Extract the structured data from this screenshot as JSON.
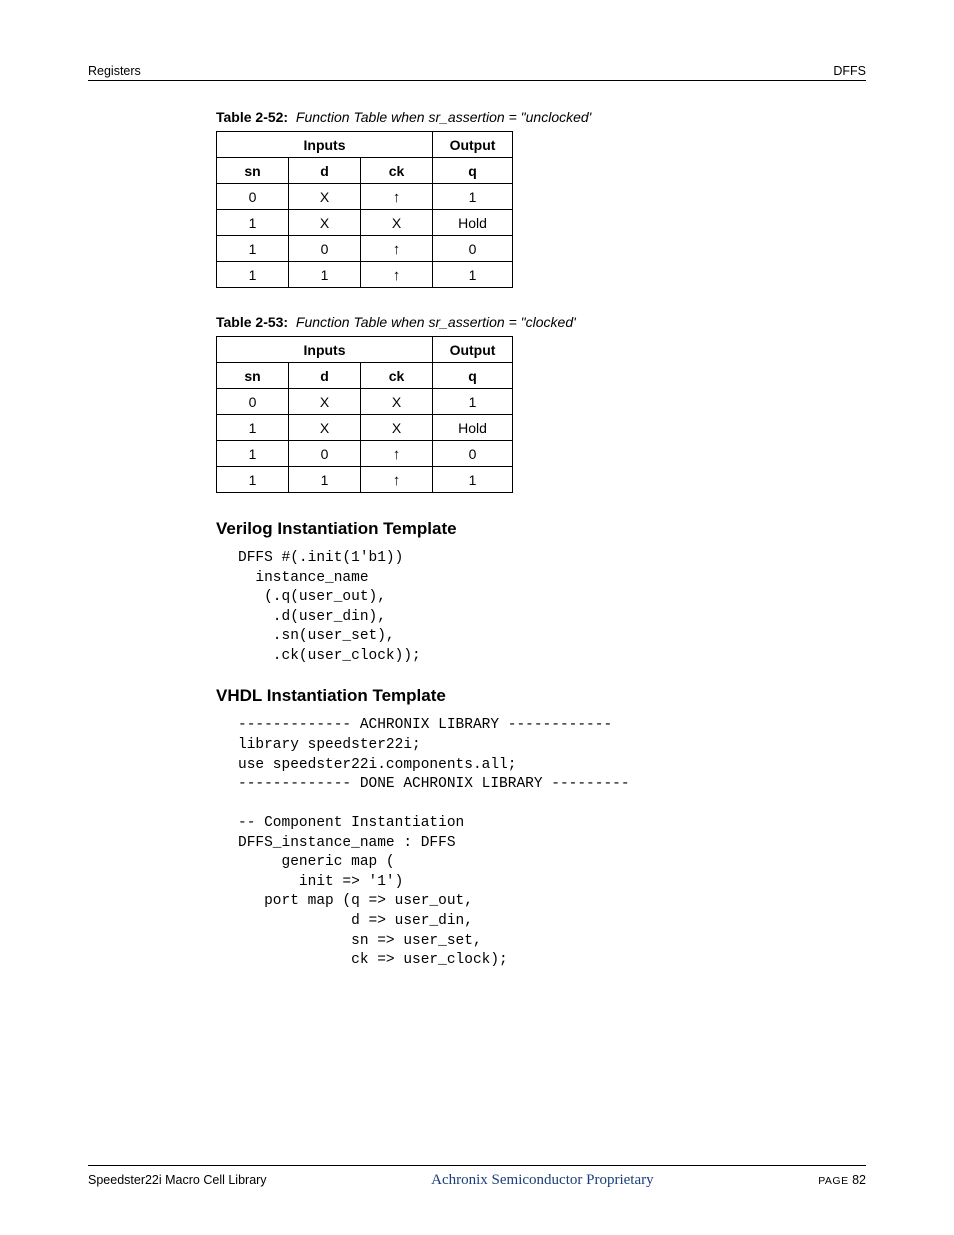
{
  "header": {
    "left": "Registers",
    "right": "DFFS"
  },
  "tables": [
    {
      "caption_label": "Table 2-52:",
      "caption_text": "Function Table when sr_assertion = \"unclocked'",
      "group_inputs": "Inputs",
      "group_output": "Output",
      "cols": [
        "sn",
        "d",
        "ck",
        "q"
      ],
      "rows": [
        [
          "0",
          "X",
          "↑",
          "1"
        ],
        [
          "1",
          "X",
          "X",
          "Hold"
        ],
        [
          "1",
          "0",
          "↑",
          "0"
        ],
        [
          "1",
          "1",
          "↑",
          "1"
        ]
      ]
    },
    {
      "caption_label": "Table 2-53:",
      "caption_text": "Function Table when sr_assertion = \"clocked'",
      "group_inputs": "Inputs",
      "group_output": "Output",
      "cols": [
        "sn",
        "d",
        "ck",
        "q"
      ],
      "rows": [
        [
          "0",
          "X",
          "X",
          "1"
        ],
        [
          "1",
          "X",
          "X",
          "Hold"
        ],
        [
          "1",
          "0",
          "↑",
          "0"
        ],
        [
          "1",
          "1",
          "↑",
          "1"
        ]
      ]
    }
  ],
  "sections": {
    "verilog_title": "Verilog Instantiation Template",
    "verilog_code": "DFFS #(.init(1'b1))\n  instance_name\n   (.q(user_out),\n    .d(user_din),\n    .sn(user_set),\n    .ck(user_clock));",
    "vhdl_title": "VHDL Instantiation Template",
    "vhdl_code": "------------- ACHRONIX LIBRARY ------------\nlibrary speedster22i;\nuse speedster22i.components.all;\n------------- DONE ACHRONIX LIBRARY ---------\n\n-- Component Instantiation\nDFFS_instance_name : DFFS\n     generic map (\n       init => '1')\n   port map (q => user_out,\n             d => user_din,\n             sn => user_set,\n             ck => user_clock);"
  },
  "footer": {
    "left": "Speedster22i Macro Cell Library",
    "center": "Achronix Semiconductor Proprietary",
    "page_label": "PAGE",
    "page_num": "82"
  }
}
